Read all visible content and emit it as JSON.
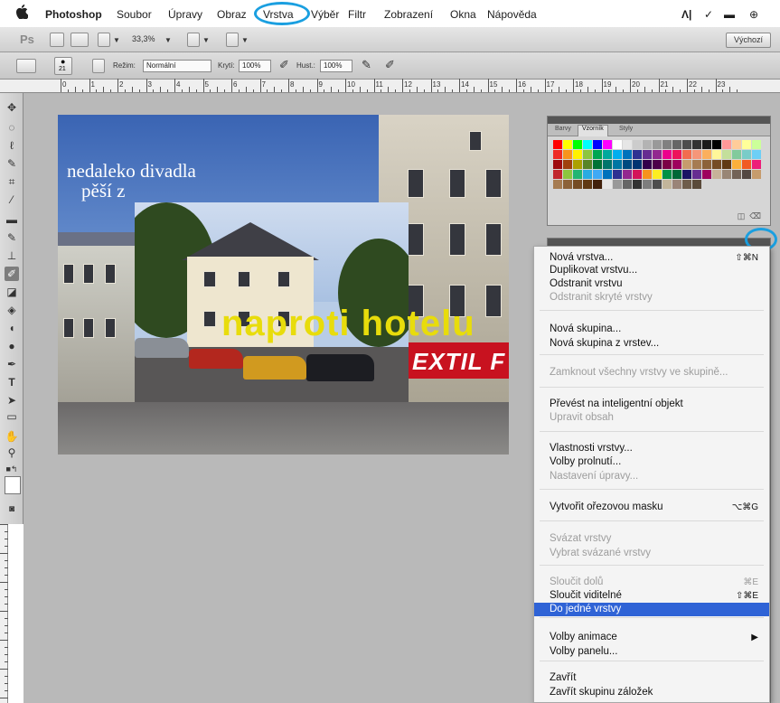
{
  "menubar": {
    "app": "Photoshop",
    "items": [
      "Soubor",
      "Úpravy",
      "Obraz",
      "Vrstva",
      "Výběr",
      "Filtr",
      "Zobrazení",
      "Okna",
      "Nápověda"
    ]
  },
  "appbar": {
    "logo": "Ps",
    "zoom": "33,3%",
    "workspace": "Výchozí"
  },
  "options": {
    "brush_size": "21",
    "mode_label": "Režim:",
    "mode_value": "Normální",
    "opacity_label": "Krytí:",
    "opacity_value": "100%",
    "flow_label": "Hust.:",
    "flow_value": "100%"
  },
  "ruler": {
    "numbers": [
      "0",
      "1",
      "2",
      "3",
      "4",
      "5",
      "6",
      "7",
      "8",
      "9",
      "10",
      "11",
      "12",
      "13",
      "14",
      "15",
      "16",
      "17",
      "18",
      "19",
      "20",
      "21",
      "22",
      "23"
    ]
  },
  "document": {
    "caption_line1": "nedaleko divadla",
    "caption_line2": "pěší z",
    "big_text": "naproti hotelu",
    "shop_sign": "EXTIL F"
  },
  "swatches_panel": {
    "tabs": [
      "Barvy",
      "Vzorník",
      "Styly"
    ],
    "active_tab": "Vzorník",
    "colors": [
      "#ff0000",
      "#ffff00",
      "#00ff00",
      "#00ffff",
      "#0000ff",
      "#ff00ff",
      "#ffffff",
      "#e6e6e6",
      "#cccccc",
      "#b3b3b3",
      "#999999",
      "#808080",
      "#666666",
      "#4d4d4d",
      "#333333",
      "#1a1a1a",
      "#000000",
      "#ff9999",
      "#ffcc99",
      "#ffff99",
      "#ccff99",
      "#ee2a24",
      "#f7941d",
      "#fff200",
      "#8dc63f",
      "#00a651",
      "#00a99d",
      "#00aeef",
      "#0072bc",
      "#2e3192",
      "#662d91",
      "#92278f",
      "#ec008c",
      "#ed145b",
      "#f26c4f",
      "#f69679",
      "#fbaf5d",
      "#fff799",
      "#c4df9b",
      "#82ca9c",
      "#7accc8",
      "#6dcff6",
      "#9e0b0f",
      "#a0410d",
      "#aba000",
      "#598527",
      "#007236",
      "#00746b",
      "#0076a3",
      "#004a80",
      "#003471",
      "#32004b",
      "#4b0049",
      "#7b0046",
      "#9e005d",
      "#c69c6d",
      "#a67c52",
      "#8c6239",
      "#754c24",
      "#603913",
      "#fbb03b",
      "#f15a24",
      "#ed1e79",
      "#c1272d",
      "#8cc63f",
      "#22b573",
      "#29abe2",
      "#3fa9f5",
      "#0071bc",
      "#2e3192",
      "#93278f",
      "#d4145a",
      "#f7931e",
      "#fcee21",
      "#009245",
      "#006837",
      "#1b1464",
      "#662d91",
      "#9e005d",
      "#c7b299",
      "#998675",
      "#736357",
      "#534741",
      "#c69c6d",
      "#a67c52",
      "#8c6239",
      "#754c24",
      "#603913",
      "#42210b",
      "#e6e6e6",
      "#999999",
      "#666666",
      "#333333",
      "#7d7d7d",
      "#4d4d4d",
      "#c2b59b",
      "#9a8478",
      "#6e5c4b",
      "#5a4a3a"
    ],
    "footer_icons": [
      "new-swatch-icon",
      "trash-icon"
    ]
  },
  "layer_menu": {
    "items": [
      {
        "label": "Nová vrstva...",
        "shortcut": "⇧⌘N",
        "state": "enabled"
      },
      {
        "label": "Duplikovat vrstvu...",
        "shortcut": "",
        "state": "enabled"
      },
      {
        "label": "Odstranit vrstvu",
        "shortcut": "",
        "state": "enabled"
      },
      {
        "label": "Odstranit skryté vrstvy",
        "shortcut": "",
        "state": "disabled"
      },
      {
        "label": "Nová skupina...",
        "shortcut": "",
        "state": "enabled"
      },
      {
        "label": "Nová skupina z vrstev...",
        "shortcut": "",
        "state": "enabled"
      },
      {
        "label": "Zamknout všechny vrstvy ve skupině...",
        "shortcut": "",
        "state": "disabled"
      },
      {
        "label": "Převést na inteligentní objekt",
        "shortcut": "",
        "state": "enabled"
      },
      {
        "label": "Upravit obsah",
        "shortcut": "",
        "state": "disabled"
      },
      {
        "label": "Vlastnosti vrstvy...",
        "shortcut": "",
        "state": "enabled"
      },
      {
        "label": "Volby prolnutí...",
        "shortcut": "",
        "state": "enabled"
      },
      {
        "label": "Nastavení úpravy...",
        "shortcut": "",
        "state": "disabled"
      },
      {
        "label": "Vytvořit ořezovou masku",
        "shortcut": "⌥⌘G",
        "state": "enabled"
      },
      {
        "label": "Svázat vrstvy",
        "shortcut": "",
        "state": "disabled"
      },
      {
        "label": "Vybrat svázané vrstvy",
        "shortcut": "",
        "state": "disabled"
      },
      {
        "label": "Sloučit dolů",
        "shortcut": "⌘E",
        "state": "disabled"
      },
      {
        "label": "Sloučit viditelné",
        "shortcut": "⇧⌘E",
        "state": "enabled"
      },
      {
        "label": "Do jedné vrstvy",
        "shortcut": "",
        "state": "selected"
      },
      {
        "label": "Volby animace",
        "shortcut": "▶",
        "state": "enabled"
      },
      {
        "label": "Volby panelu...",
        "shortcut": "",
        "state": "enabled"
      },
      {
        "label": "Zavřít",
        "shortcut": "",
        "state": "enabled"
      },
      {
        "label": "Zavřít skupinu záložek",
        "shortcut": "",
        "state": "enabled"
      }
    ]
  },
  "colors": {
    "highlight_ring": "#1a9fe0",
    "menu_selection": "#2f63d6",
    "caption_yellow": "#e8dc0b",
    "workspace_gray": "#b9b9b9"
  }
}
